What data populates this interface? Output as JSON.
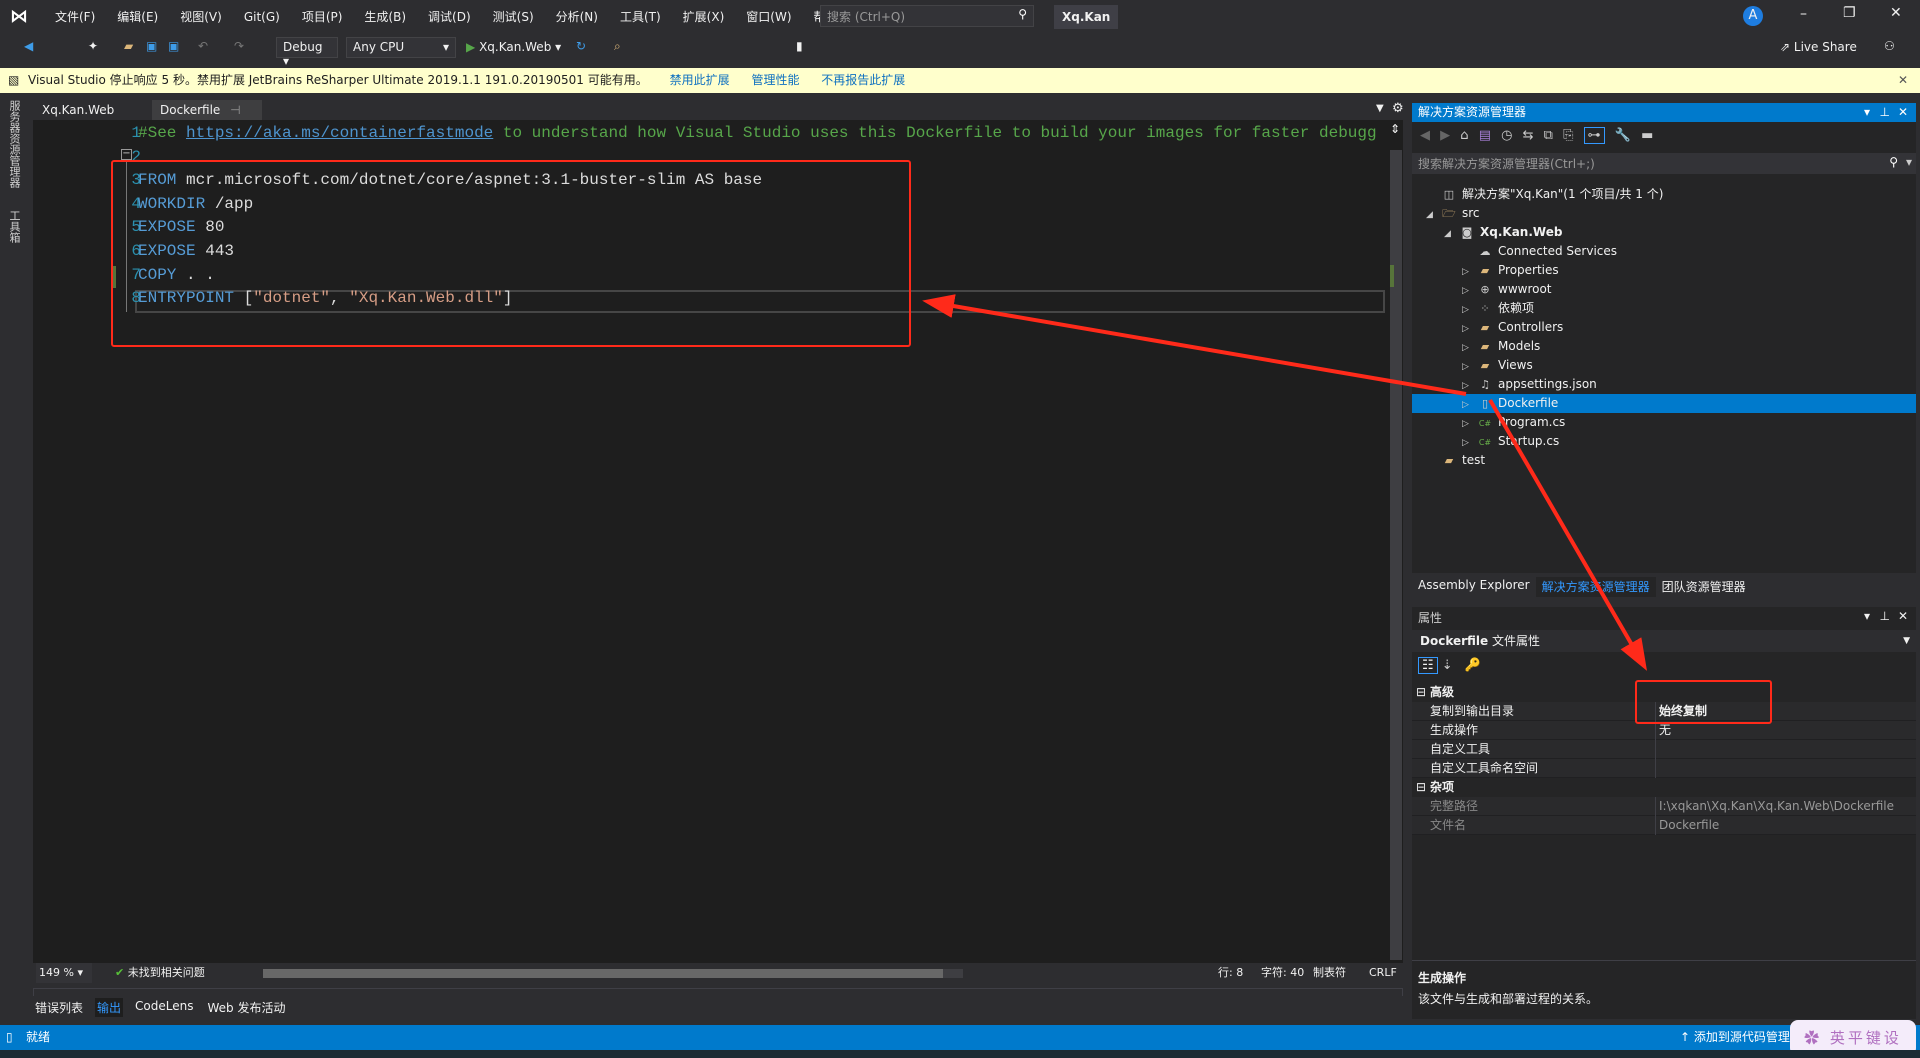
{
  "app": {
    "title": "Xq.Kan",
    "account_initial": "A"
  },
  "menu": [
    "文件(F)",
    "编辑(E)",
    "视图(V)",
    "Git(G)",
    "项目(P)",
    "生成(B)",
    "调试(D)",
    "测试(S)",
    "分析(N)",
    "工具(T)",
    "扩展(X)",
    "窗口(W)",
    "帮助(H)"
  ],
  "search": {
    "placeholder": "搜索 (Ctrl+Q)"
  },
  "toolbar": {
    "config": "Debug",
    "platform": "Any CPU",
    "run_target": "Xq.Kan.Web",
    "live_share": "Live Share"
  },
  "infobar": {
    "message": "Visual Studio 停止响应 5 秒。禁用扩展 JetBrains ReSharper Ultimate 2019.1.1 191.0.20190501 可能有用。",
    "links": [
      "禁用此扩展",
      "管理性能",
      "不再报告此扩展"
    ]
  },
  "left_strip": [
    "服务器资源管理器",
    "工具箱"
  ],
  "doc_tabs": [
    {
      "label": "Xq.Kan.Web",
      "active": false
    },
    {
      "label": "Dockerfile",
      "active": true
    }
  ],
  "editor": {
    "line_numbers": [
      "1",
      "2",
      "3",
      "4",
      "5",
      "6",
      "7",
      "8"
    ],
    "lines": [
      [
        {
          "t": "#See ",
          "c": "cm"
        },
        {
          "t": "https://aka.ms/containerfastmode",
          "c": "lnk"
        },
        {
          "t": " to understand how Visual Studio uses this Dockerfile to build your images for faster debugg",
          "c": "cm"
        }
      ],
      [],
      [
        {
          "t": "FROM",
          "c": "kw"
        },
        {
          "t": " mcr.microsoft.com/dotnet/core/aspnet:3.1-buster-slim AS base",
          "c": ""
        }
      ],
      [
        {
          "t": "WORKDIR",
          "c": "kw"
        },
        {
          "t": " /app",
          "c": ""
        }
      ],
      [
        {
          "t": "EXPOSE",
          "c": "kw"
        },
        {
          "t": " 80",
          "c": ""
        }
      ],
      [
        {
          "t": "EXPOSE",
          "c": "kw"
        },
        {
          "t": " 443",
          "c": ""
        }
      ],
      [
        {
          "t": "COPY",
          "c": "kw"
        },
        {
          "t": " . .",
          "c": ""
        }
      ],
      [
        {
          "t": "ENTRYPOINT",
          "c": "kw"
        },
        {
          "t": " [",
          "c": ""
        },
        {
          "t": "\"dotnet\"",
          "c": "str"
        },
        {
          "t": ", ",
          "c": ""
        },
        {
          "t": "\"Xq.Kan.Web.dll\"",
          "c": "str"
        },
        {
          "t": "]",
          "c": ""
        }
      ]
    ]
  },
  "editor_status": {
    "zoom": "149 %",
    "issues": "未找到相关问题",
    "line": "行: 8",
    "char": "字符: 40",
    "indent": "制表符",
    "eol": "CRLF"
  },
  "output_tabs": [
    {
      "label": "错误列表",
      "active": false
    },
    {
      "label": "输出",
      "active": true
    },
    {
      "label": "CodeLens",
      "active": false
    },
    {
      "label": "Web 发布活动",
      "active": false
    }
  ],
  "statusbar": {
    "ready": "就绪",
    "source_control": "添加到源代码管理"
  },
  "solution_explorer": {
    "title": "解决方案资源管理器",
    "search_placeholder": "搜索解决方案资源管理器(Ctrl+;)",
    "items": [
      {
        "label": "解决方案\"Xq.Kan\"(1 个项目/共 1 个)",
        "depth": 0,
        "toggle": "",
        "icon": "solution-icon"
      },
      {
        "label": "src",
        "depth": 0,
        "toggle": "◢",
        "icon": "folder-open-icon"
      },
      {
        "label": "Xq.Kan.Web",
        "depth": 1,
        "toggle": "◢",
        "icon": "web-project-icon",
        "bold": true
      },
      {
        "label": "Connected Services",
        "depth": 2,
        "toggle": "",
        "icon": "cloud-icon"
      },
      {
        "label": "Properties",
        "depth": 2,
        "toggle": "▷",
        "icon": "properties-folder-icon"
      },
      {
        "label": "wwwroot",
        "depth": 2,
        "toggle": "▷",
        "icon": "globe-icon"
      },
      {
        "label": "依赖项",
        "depth": 2,
        "toggle": "▷",
        "icon": "dependencies-icon"
      },
      {
        "label": "Controllers",
        "depth": 2,
        "toggle": "▷",
        "icon": "folder-icon"
      },
      {
        "label": "Models",
        "depth": 2,
        "toggle": "▷",
        "icon": "folder-icon"
      },
      {
        "label": "Views",
        "depth": 2,
        "toggle": "▷",
        "icon": "folder-icon"
      },
      {
        "label": "appsettings.json",
        "depth": 2,
        "toggle": "▷",
        "icon": "json-file-icon"
      },
      {
        "label": "Dockerfile",
        "depth": 2,
        "toggle": "▷",
        "icon": "file-icon",
        "selected": true
      },
      {
        "label": "Program.cs",
        "depth": 2,
        "toggle": "▷",
        "icon": "csharp-file-icon"
      },
      {
        "label": "Startup.cs",
        "depth": 2,
        "toggle": "▷",
        "icon": "csharp-file-icon"
      },
      {
        "label": "test",
        "depth": 0,
        "toggle": "",
        "icon": "folder-icon"
      }
    ],
    "bottom_tabs": [
      {
        "label": "Assembly Explorer",
        "active": false
      },
      {
        "label": "解决方案资源管理器",
        "active": true
      },
      {
        "label": "团队资源管理器",
        "active": false
      }
    ]
  },
  "properties": {
    "title": "属性",
    "object": "Dockerfile",
    "object_type": "文件属性",
    "rows": [
      {
        "kind": "cat",
        "name": "高级"
      },
      {
        "kind": "prop",
        "name": "复制到输出目录",
        "value": "始终复制",
        "bold": true
      },
      {
        "kind": "prop",
        "name": "生成操作",
        "value": "无"
      },
      {
        "kind": "prop",
        "name": "自定义工具",
        "value": ""
      },
      {
        "kind": "prop",
        "name": "自定义工具命名空间",
        "value": ""
      },
      {
        "kind": "cat",
        "name": "杂项"
      },
      {
        "kind": "prop",
        "name": "完整路径",
        "value": "I:\\xqkan\\Xq.Kan\\Xq.Kan.Web\\Dockerfile",
        "dim": true
      },
      {
        "kind": "prop",
        "name": "文件名",
        "value": "Dockerfile",
        "dim": true
      }
    ],
    "desc_title": "生成操作",
    "desc_text": "该文件与生成和部署过程的关系。"
  },
  "watermark": "英平键设",
  "colors": {
    "accent": "#007acc",
    "annotation": "#ff2a1a",
    "info_bg": "#ffffcc"
  }
}
